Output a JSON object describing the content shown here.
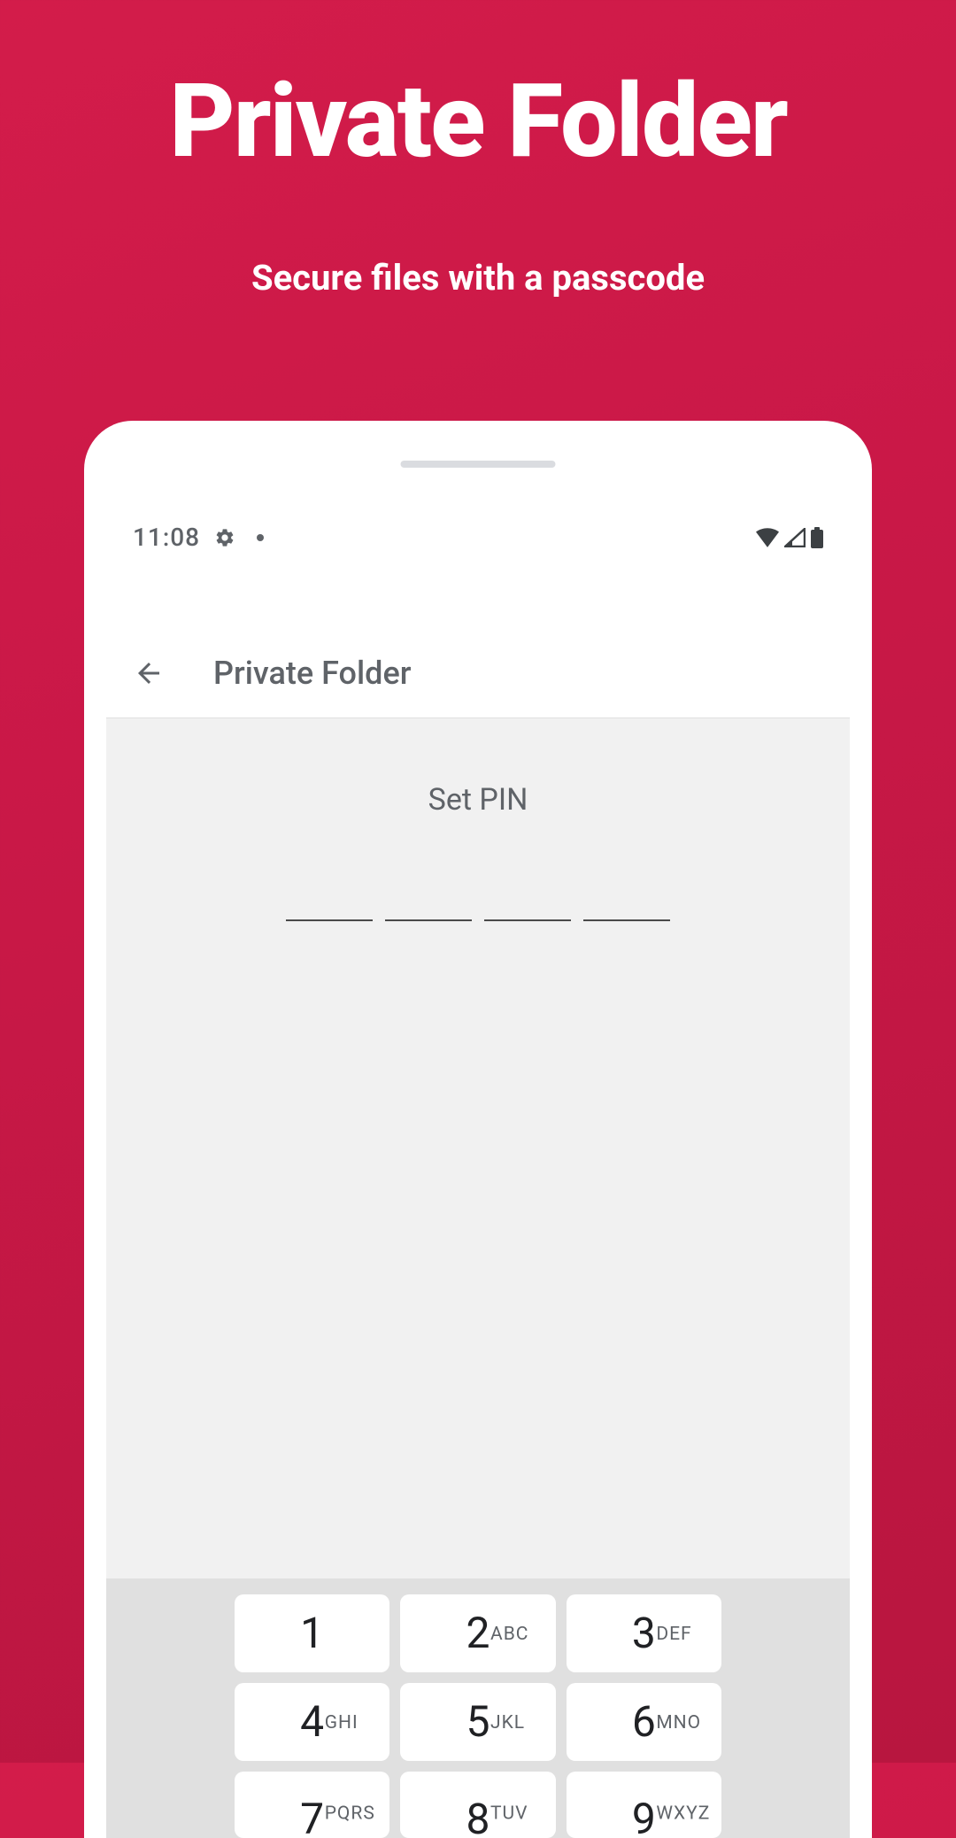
{
  "promo": {
    "title": "Private Folder",
    "subtitle": "Secure files with a passcode"
  },
  "statusbar": {
    "time": "11:08"
  },
  "appbar": {
    "title": "Private Folder"
  },
  "main": {
    "set_pin_label": "Set PIN"
  },
  "keypad": [
    {
      "num": "1",
      "letters": ""
    },
    {
      "num": "2",
      "letters": "ABC"
    },
    {
      "num": "3",
      "letters": "DEF"
    },
    {
      "num": "4",
      "letters": "GHI"
    },
    {
      "num": "5",
      "letters": "JKL"
    },
    {
      "num": "6",
      "letters": "MNO"
    },
    {
      "num": "7",
      "letters": "PQRS"
    },
    {
      "num": "8",
      "letters": "TUV"
    },
    {
      "num": "9",
      "letters": "WXYZ"
    }
  ]
}
